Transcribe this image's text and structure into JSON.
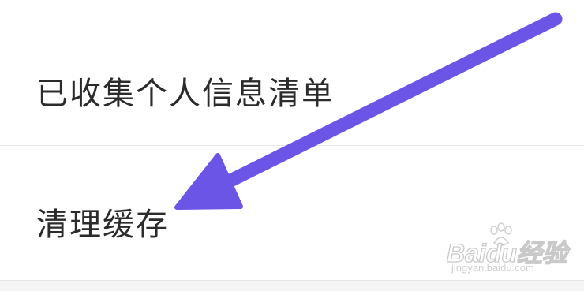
{
  "settings_list": {
    "items": [
      {
        "label": "已收集个人信息清单"
      },
      {
        "label": "清理缓存"
      }
    ]
  },
  "annotation": {
    "arrow_color": "#6a55e6",
    "points_to": "清理缓存"
  },
  "watermark": {
    "brand": "Baidu经验",
    "url": "jingyan.baidu.com"
  }
}
